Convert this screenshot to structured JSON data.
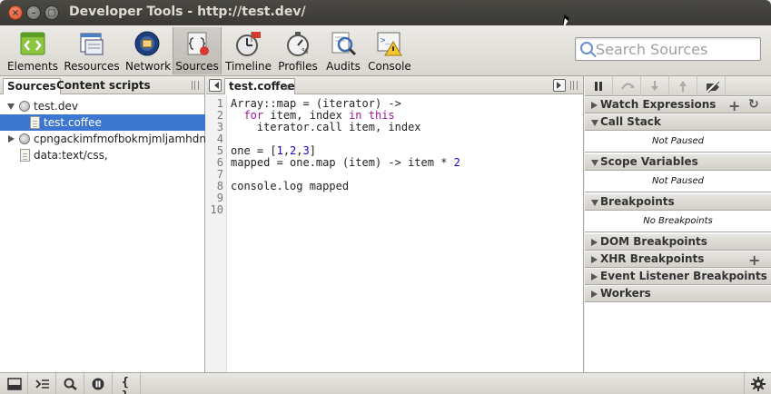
{
  "window": {
    "title": "Developer Tools - http://test.dev/"
  },
  "toolbar": {
    "tools": [
      {
        "label": "Elements"
      },
      {
        "label": "Resources"
      },
      {
        "label": "Network"
      },
      {
        "label": "Sources"
      },
      {
        "label": "Timeline"
      },
      {
        "label": "Profiles"
      },
      {
        "label": "Audits"
      },
      {
        "label": "Console"
      }
    ],
    "selected": "Sources",
    "search_placeholder": "Search Sources"
  },
  "left_panel": {
    "tabs": [
      "Sources",
      "Content scripts"
    ],
    "tree": [
      {
        "label": "test.dev"
      },
      {
        "label": "test.coffee"
      },
      {
        "label": "cpngackimfmofbokmjmljamhdncknpmg"
      },
      {
        "label": "data:text/css,"
      }
    ]
  },
  "editor": {
    "tab_label": "test.coffee",
    "close_glyph": "×",
    "line_numbers": [
      "1",
      "2",
      "3",
      "4",
      "5",
      "6",
      "7",
      "8",
      "9",
      "10"
    ],
    "lines": [
      "Array::map = (iterator) ->",
      "  for item, index in this",
      "    iterator.call item, index",
      "",
      "one = [1,2,3]",
      "mapped = one.map (item) -> item * 2",
      "",
      "console.log mapped",
      "",
      ""
    ]
  },
  "sidebar": {
    "panes": [
      {
        "title": "Watch Expressions"
      },
      {
        "title": "Call Stack",
        "body": "Not Paused"
      },
      {
        "title": "Scope Variables",
        "body": "Not Paused"
      },
      {
        "title": "Breakpoints",
        "body": "No Breakpoints"
      },
      {
        "title": "DOM Breakpoints"
      },
      {
        "title": "XHR Breakpoints"
      },
      {
        "title": "Event Listener Breakpoints"
      },
      {
        "title": "Workers"
      }
    ],
    "plus_glyph": "+",
    "refresh_glyph": "↻"
  },
  "statusbar": {
    "format_label": "{ }"
  }
}
